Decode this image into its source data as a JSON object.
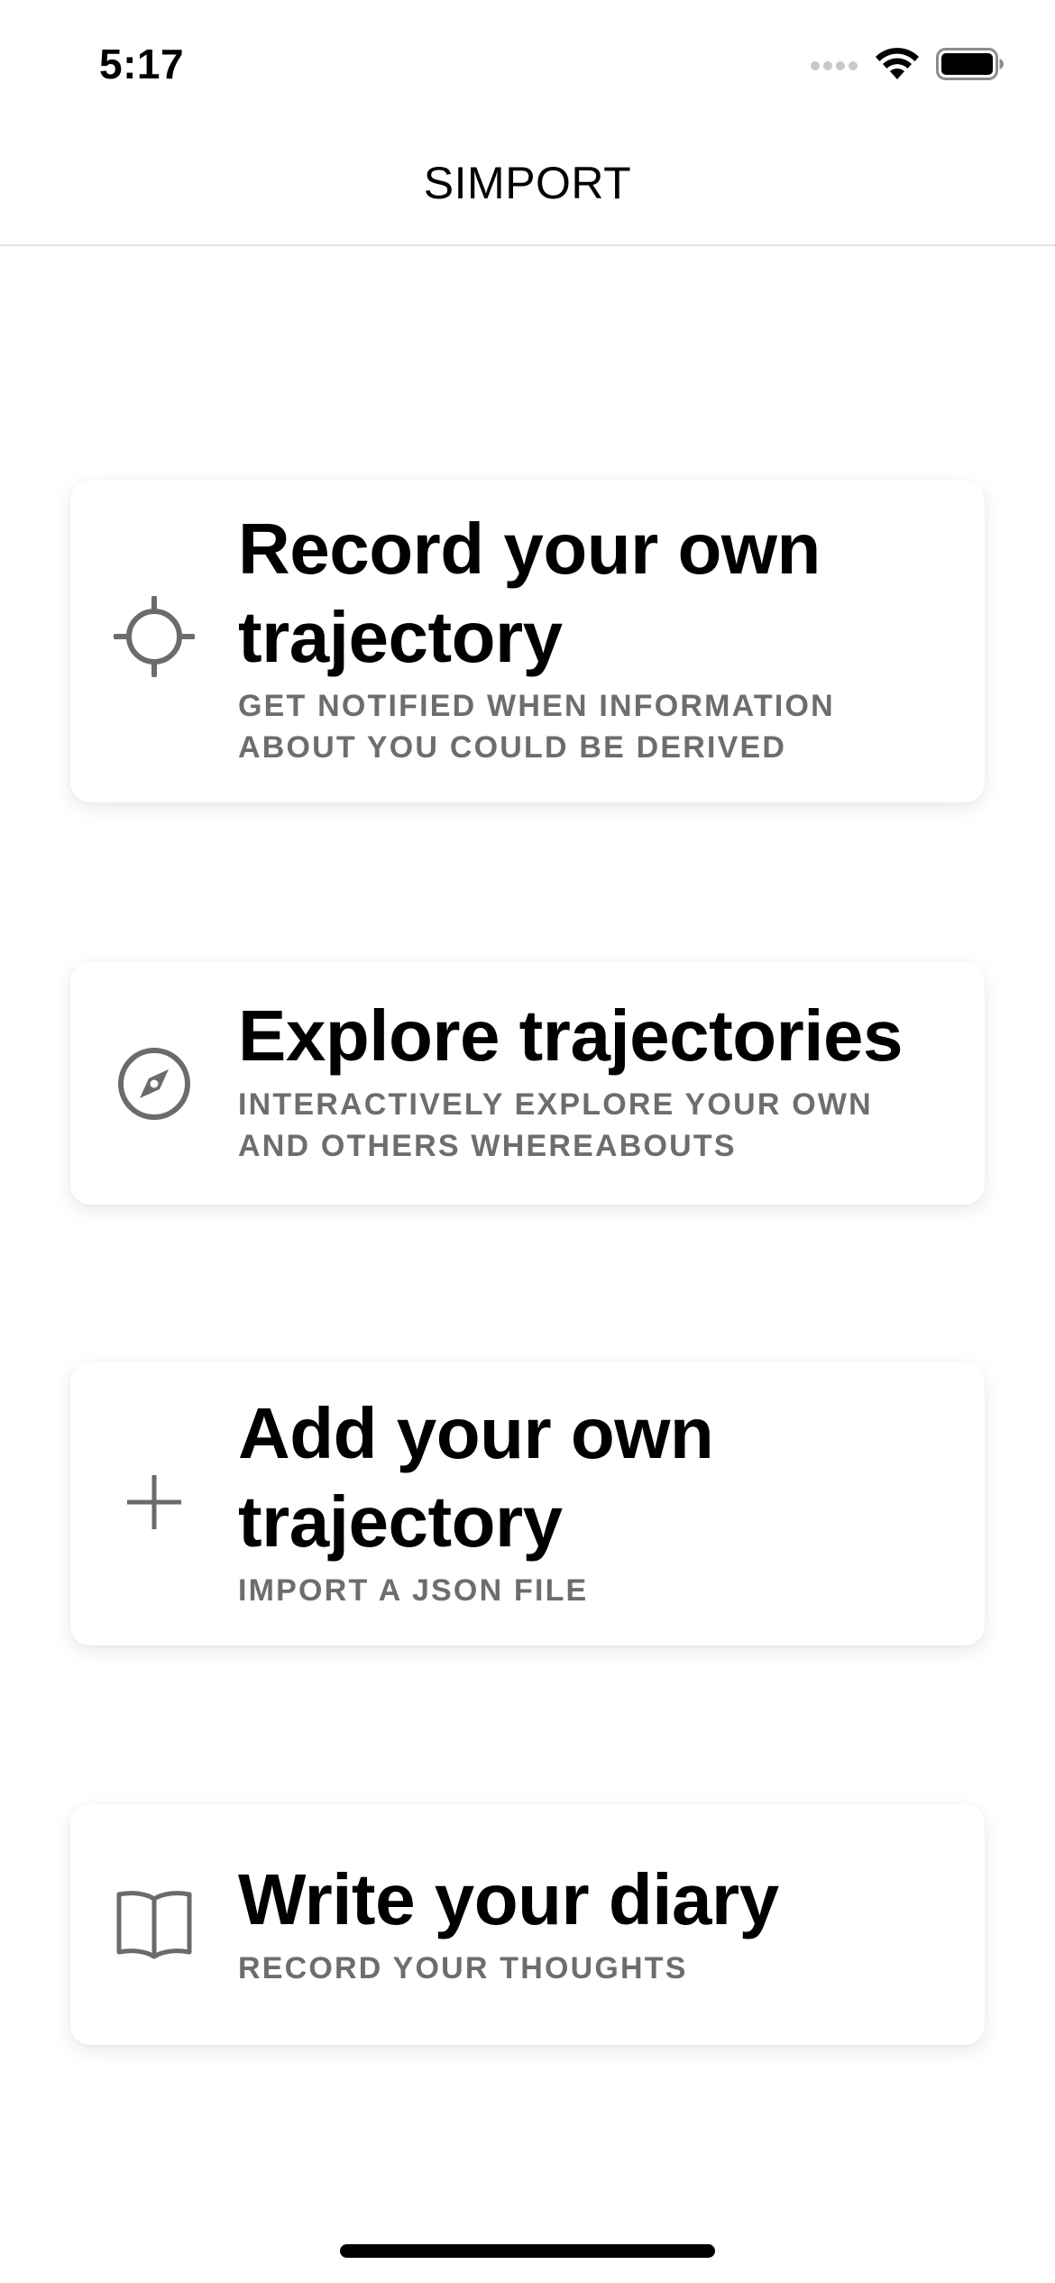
{
  "status_bar": {
    "time": "5:17"
  },
  "nav": {
    "title": "SIMPORT"
  },
  "cards": [
    {
      "title": "Record your own trajectory",
      "subtitle": "GET NOTIFIED WHEN INFORMATION ABOUT YOU COULD BE DERIVED",
      "icon": "crosshair-icon"
    },
    {
      "title": "Explore trajectories",
      "subtitle": "INTERACTIVELY EXPLORE YOUR OWN AND OTHERS WHEREABOUTS",
      "icon": "compass-icon"
    },
    {
      "title": "Add your own trajectory",
      "subtitle": "IMPORT A JSON FILE",
      "icon": "plus-icon"
    },
    {
      "title": "Write your diary",
      "subtitle": "RECORD YOUR THOUGHTS",
      "icon": "book-icon"
    }
  ],
  "colors": {
    "title": "#000000",
    "subtitle": "#6d6d6d",
    "icon": "#6b6b6b",
    "divider": "#e2e2e2"
  }
}
